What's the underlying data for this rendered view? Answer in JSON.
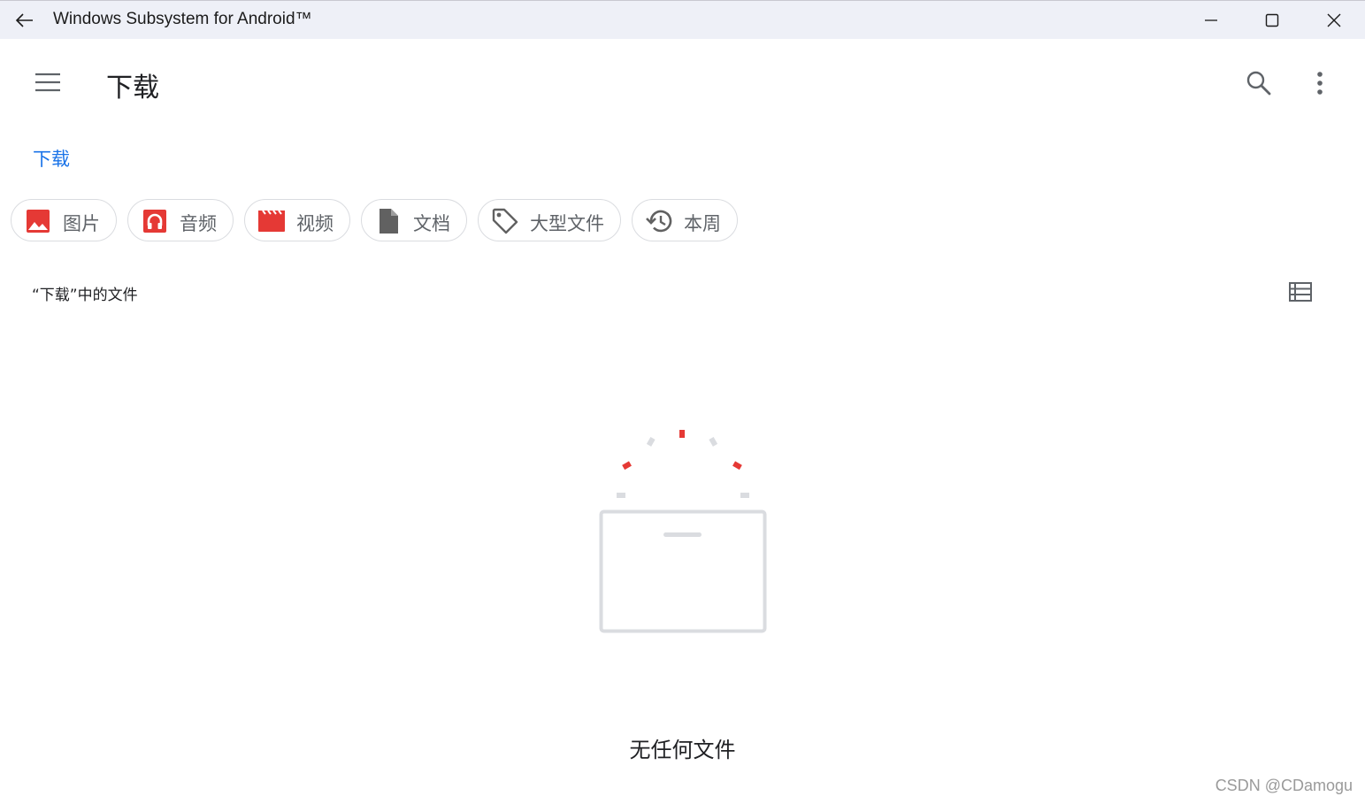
{
  "window": {
    "title": "Windows Subsystem for Android™",
    "back_icon": "back-arrow-icon",
    "minimize_icon": "minimize-icon",
    "maximize_icon": "maximize-icon",
    "close_icon": "close-icon"
  },
  "app_bar": {
    "title": "下载",
    "menu_icon": "hamburger-menu-icon",
    "search_icon": "search-icon",
    "more_icon": "more-vert-icon"
  },
  "breadcrumb": {
    "items": [
      "下载"
    ]
  },
  "chips": [
    {
      "label": "图片",
      "icon": "image-icon",
      "icon_color": "#e53935"
    },
    {
      "label": "音频",
      "icon": "headphones-icon",
      "icon_color": "#e53935"
    },
    {
      "label": "视频",
      "icon": "movie-icon",
      "icon_color": "#e53935"
    },
    {
      "label": "文档",
      "icon": "document-icon",
      "icon_color": "#616161"
    },
    {
      "label": "大型文件",
      "icon": "tag-icon",
      "icon_color": "#616161"
    },
    {
      "label": "本周",
      "icon": "history-icon",
      "icon_color": "#616161"
    }
  ],
  "section": {
    "title": "“下载”中的文件",
    "view_toggle_icon": "list-view-icon"
  },
  "empty_state": {
    "illustration_icon": "empty-box-icon",
    "message": "无任何文件"
  },
  "watermark": "CSDN @CDamogu",
  "colors": {
    "accent": "#1a73e8",
    "chip_red": "#e53935",
    "titlebar_bg": "#eef0f7"
  }
}
